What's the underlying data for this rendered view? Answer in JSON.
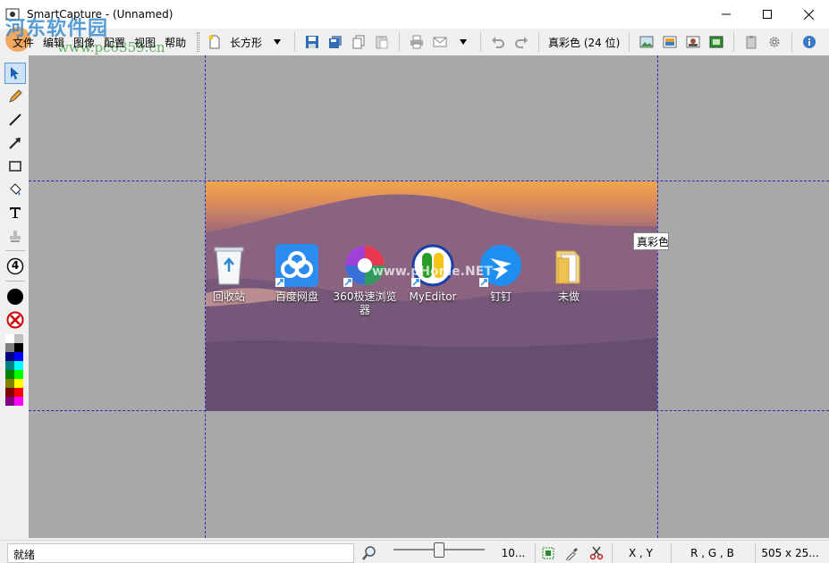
{
  "window": {
    "title": "SmartCapture - (Unnamed)"
  },
  "watermark": {
    "logo": "河东软件园",
    "url": "www.pc0359.cn",
    "overlay": "www.pHome.NET"
  },
  "menu": [
    "文件",
    "编辑",
    "图像",
    "配置",
    "视图",
    "帮助"
  ],
  "toolbar": {
    "shape_label": "长方形",
    "color_mode_label": "真彩色 (24 位)"
  },
  "palette": {
    "tools": [
      "select-arrow",
      "pencil",
      "line",
      "arrow-line",
      "rectangle",
      "fill-bucket",
      "text",
      "stamp"
    ],
    "line_width": "4",
    "colors": [
      "#ffffff",
      "#c0c0c0",
      "#808080",
      "#000000",
      "#000080",
      "#0000ff",
      "#008080",
      "#00ffff",
      "#008000",
      "#00ff00",
      "#808000",
      "#ffff00",
      "#800000",
      "#ff0000",
      "#800080",
      "#ff00ff"
    ]
  },
  "desktop_icons": [
    {
      "label": "回收站",
      "icon": "recycle-bin-icon"
    },
    {
      "label": "百度网盘",
      "icon": "baidu-netdisk-icon"
    },
    {
      "label": "360极速浏览器",
      "icon": "360-browser-icon"
    },
    {
      "label": "MyEditor",
      "icon": "myeditor-icon"
    },
    {
      "label": "钉钉",
      "icon": "dingtalk-icon"
    },
    {
      "label": "未做",
      "icon": "folder-icon"
    }
  ],
  "tooltip": "真彩色",
  "status": {
    "text": "就绪",
    "zoom": "10...",
    "zoom_level": 0.5,
    "coords": "X , Y",
    "rgb": "R , G , B",
    "size": "505 x 25..."
  }
}
